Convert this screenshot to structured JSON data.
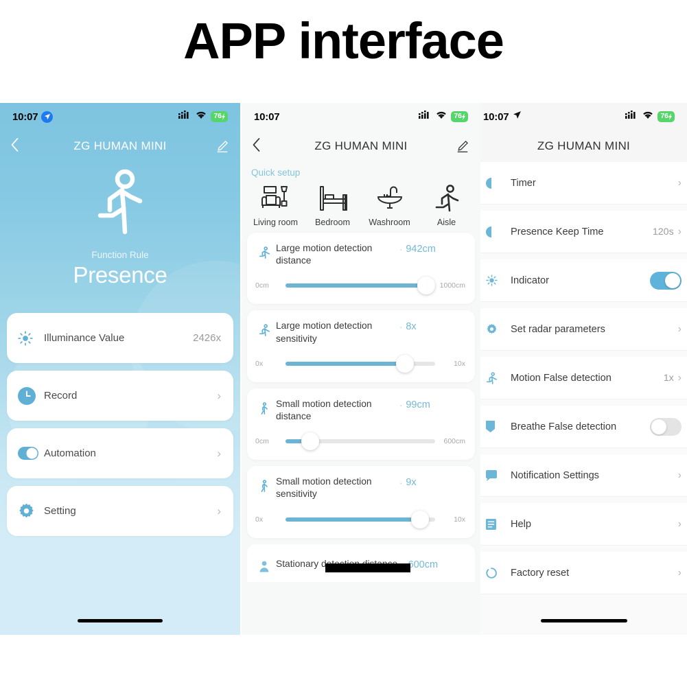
{
  "page": {
    "title": "APP interface"
  },
  "panel1": {
    "status": {
      "time": "10:07",
      "battery": "76",
      "location_icon": "location-arrow-icon"
    },
    "nav": {
      "back_icon": "chevron-left-icon",
      "title": "ZG HUMAN MINI",
      "edit_icon": "pencil-edit-icon"
    },
    "hero": {
      "icon": "running-person-icon",
      "subtitle": "Function Rule",
      "title": "Presence"
    },
    "cards": [
      {
        "icon": "brightness-sun-icon",
        "label": "Illuminance Value",
        "value": "2426x",
        "chevron": false
      },
      {
        "icon": "clock-icon",
        "label": "Record",
        "value": "",
        "chevron": true
      },
      {
        "icon": "toggle-switch-icon",
        "label": "Automation",
        "value": "",
        "chevron": true
      },
      {
        "icon": "gear-icon",
        "label": "Setting",
        "value": "",
        "chevron": true
      }
    ]
  },
  "panel2": {
    "status": {
      "time": "10:07",
      "battery": "76"
    },
    "nav": {
      "back_icon": "chevron-left-icon",
      "title": "ZG HUMAN MINI",
      "edit_icon": "pencil-edit-icon"
    },
    "quick_setup": {
      "label": "Quick setup",
      "items": [
        {
          "icon": "sofa-lamp-icon",
          "name": "Living room"
        },
        {
          "icon": "bed-icon",
          "name": "Bedroom"
        },
        {
          "icon": "sink-faucet-icon",
          "name": "Washroom"
        },
        {
          "icon": "running-person-icon",
          "name": "Aisle"
        }
      ]
    },
    "sliders": [
      {
        "icon": "running-person-icon",
        "title": "Large motion detection distance",
        "value": "942cm",
        "min_label": "0cm",
        "max_label": "1000cm",
        "percent": 94
      },
      {
        "icon": "running-person-icon",
        "title": "Large motion detection sensitivity",
        "value": "8x",
        "min_label": "0x",
        "max_label": "10x",
        "percent": 80
      },
      {
        "icon": "walking-person-icon",
        "title": "Small motion detection distance",
        "value": "99cm",
        "min_label": "0cm",
        "max_label": "600cm",
        "percent": 16.5
      },
      {
        "icon": "walking-person-icon",
        "title": "Small motion detection sensitivity",
        "value": "9x",
        "min_label": "0x",
        "max_label": "10x",
        "percent": 90
      }
    ],
    "stationary": {
      "icon": "person-standing-icon",
      "title": "Stationary detection distance",
      "value": "600cm",
      "redacted": true
    }
  },
  "panel3": {
    "status": {
      "time": "10:07",
      "battery": "76",
      "location_icon": "location-arrow-icon"
    },
    "nav": {
      "title": "ZG HUMAN MINI"
    },
    "rows": [
      {
        "icon": "moon-timer-icon",
        "label": "Timer",
        "value": "",
        "control": "chevron"
      },
      {
        "icon": "moon-timer-icon",
        "label": "Presence Keep Time",
        "value": "120s",
        "control": "chevron"
      },
      {
        "icon": "indicator-light-icon",
        "label": "Indicator",
        "value": "",
        "control": "toggle-on"
      },
      {
        "icon": "gear-icon",
        "label": "Set radar parameters",
        "value": "",
        "control": "chevron"
      },
      {
        "icon": "running-person-icon",
        "label": "Motion False detection",
        "value": "1x",
        "control": "chevron"
      },
      {
        "icon": "breathe-tag-icon",
        "label": "Breathe False detection",
        "value": "",
        "control": "toggle-off"
      },
      {
        "icon": "notification-bubble-icon",
        "label": "Notification Settings",
        "value": "",
        "control": "chevron"
      },
      {
        "icon": "help-list-icon",
        "label": "Help",
        "value": "",
        "control": "chevron"
      },
      {
        "icon": "reset-circle-icon",
        "label": "Factory reset",
        "value": "",
        "control": "chevron"
      }
    ]
  },
  "colors": {
    "accent_blue": "#6cb4d4",
    "hero_gradient_top": "#7ec4e0",
    "hero_gradient_bottom": "#d4ecf7",
    "battery_green": "#56d56a",
    "quick_label_blue": "#85c4dd"
  }
}
